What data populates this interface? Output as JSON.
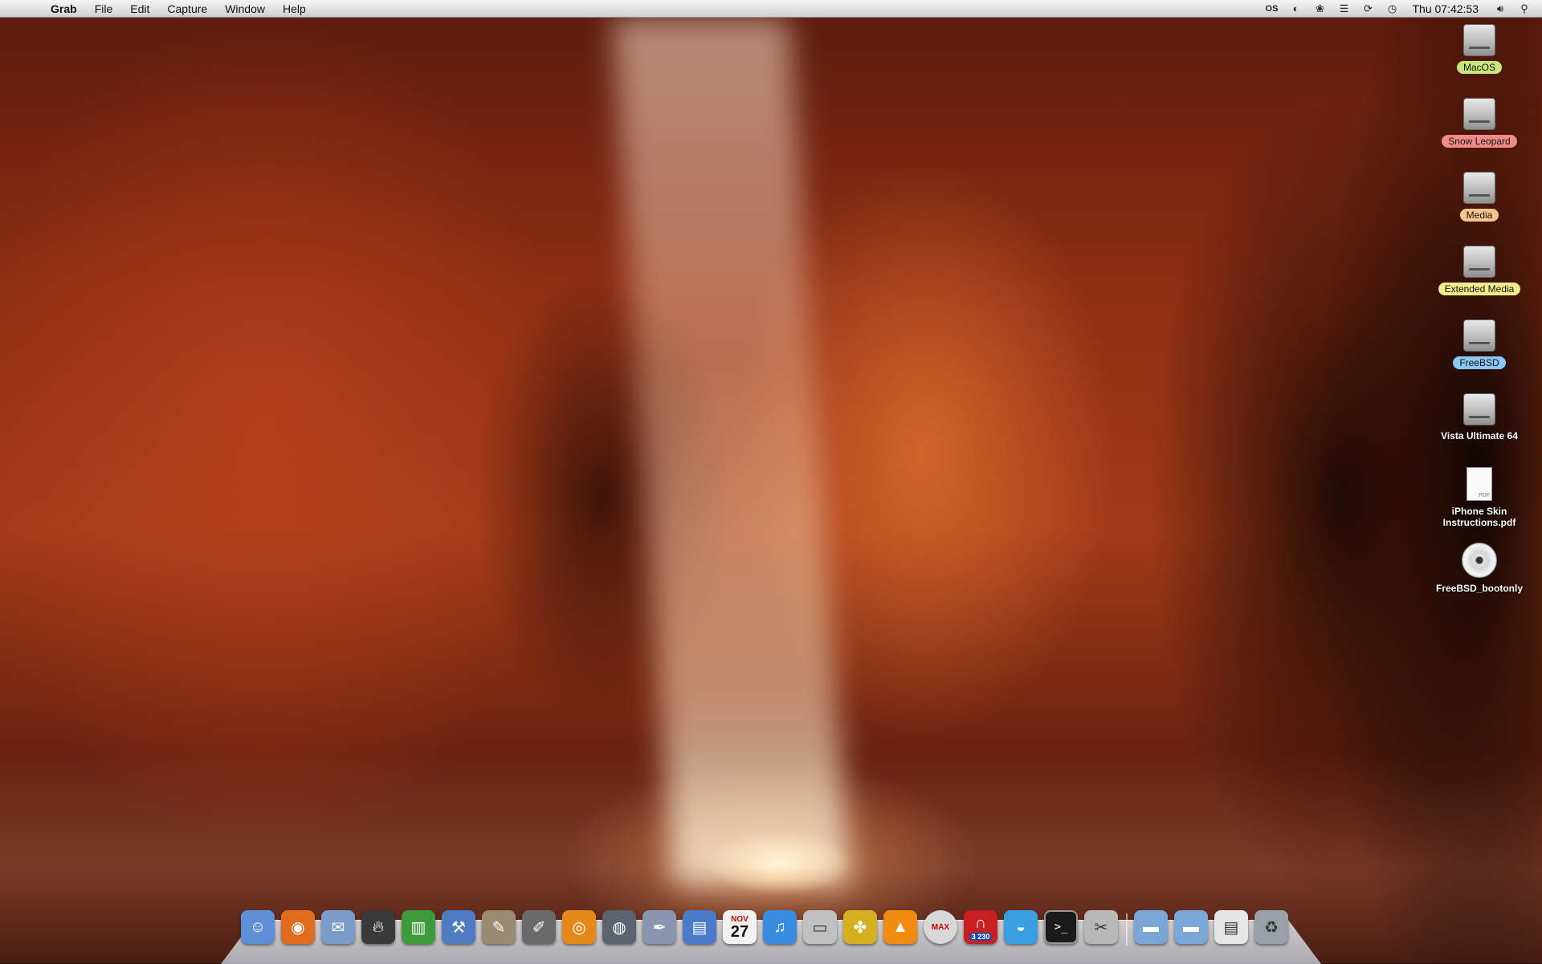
{
  "menubar": {
    "apple_glyph": "",
    "app_name": "Grab",
    "menus": [
      "File",
      "Edit",
      "Capture",
      "Window",
      "Help"
    ],
    "status_icons": [
      "os-icon",
      "moon-icon",
      "paw-icon",
      "wifi-list-icon",
      "sync-icon",
      "time-machine-icon"
    ],
    "clock": "Thu 07:42:53",
    "volume_icon": "speaker-icon",
    "spotlight_icon": "magnifier-icon"
  },
  "desktop": {
    "items": [
      {
        "label": "MacOS",
        "type": "drive",
        "tag_color": "#c7e87a"
      },
      {
        "label": "Snow Leopard",
        "type": "drive",
        "tag_color": "#f28a8a"
      },
      {
        "label": "Media",
        "type": "drive",
        "tag_color": "#f6c78c"
      },
      {
        "label": "Extended Media",
        "type": "drive",
        "tag_color": "#f4ec8c"
      },
      {
        "label": "FreeBSD",
        "type": "drive",
        "tag_color": "#8cc6f4"
      },
      {
        "label": "Vista Ultimate 64",
        "type": "drive",
        "tag_color": ""
      },
      {
        "label": "iPhone Skin Instructions.pdf",
        "type": "pdf",
        "tag_color": ""
      },
      {
        "label": "FreeBSD_bootonly",
        "type": "cd",
        "tag_color": ""
      }
    ],
    "pdf_badge": "PDF"
  },
  "dock": {
    "apps": [
      {
        "name": "finder-icon",
        "color": "#5f8fd6"
      },
      {
        "name": "firefox-icon",
        "color": "#e06a1e"
      },
      {
        "name": "mail-icon",
        "color": "#7a9cc8"
      },
      {
        "name": "burn-icon",
        "color": "#3a3a3a"
      },
      {
        "name": "books-icon",
        "color": "#3e9a3a"
      },
      {
        "name": "xcode-icon",
        "color": "#4f7cc0"
      },
      {
        "name": "gimp-icon",
        "color": "#9a8c72"
      },
      {
        "name": "pencil-icon",
        "color": "#6a6a6a"
      },
      {
        "name": "blender-icon",
        "color": "#e48a1a"
      },
      {
        "name": "disk-utility-icon",
        "color": "#5a6470"
      },
      {
        "name": "script-editor-icon",
        "color": "#8a96b0"
      },
      {
        "name": "chart-app-icon",
        "color": "#4a7ac8"
      },
      {
        "name": "calendar-icon",
        "color": "#f2f2f2"
      },
      {
        "name": "itunes-icon",
        "color": "#3a8ce0"
      },
      {
        "name": "toaster-icon",
        "color": "#c0c0c0"
      },
      {
        "name": "pineapple-icon",
        "color": "#d4b020"
      },
      {
        "name": "vlc-icon",
        "color": "#f08a10"
      },
      {
        "name": "max-cd-icon",
        "color": "#d8d8d8"
      },
      {
        "name": "magnet-icon",
        "color": "#c82020"
      },
      {
        "name": "beach-ball-icon",
        "color": "#38a0e0"
      },
      {
        "name": "terminal-icon",
        "color": "#1a1a1a"
      },
      {
        "name": "screenshot-tool-icon",
        "color": "#b8b8b8"
      }
    ],
    "folders": [
      {
        "name": "applications-folder-icon",
        "color": "#7aa6d8"
      },
      {
        "name": "documents-folder-icon",
        "color": "#7aa6d8"
      },
      {
        "name": "downloads-stack-icon",
        "color": "#e6e6e6"
      },
      {
        "name": "trash-icon",
        "color": "#9aa0a8"
      }
    ],
    "calendar_day": "27",
    "calendar_month": "NOV",
    "magnet_badge": "3 230",
    "max_label": "MAX"
  }
}
